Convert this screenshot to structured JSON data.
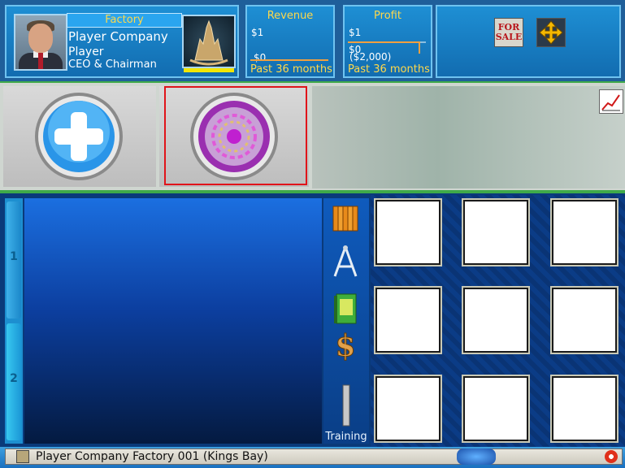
{
  "header": {
    "facility_type": "Factory",
    "company_name": "Player Company",
    "player_name": "Player",
    "player_title": "CEO & Chairman"
  },
  "revenue_chart": {
    "title": "Revenue",
    "top_label": "$1",
    "bottom_label": "$0",
    "footer": "Past 36 months",
    "line_color": "#f0a040"
  },
  "profit_chart": {
    "title": "Profit",
    "top_label": "$1",
    "mid_label": "$0",
    "bottom_label": "($2,000)",
    "footer": "Past 36 months",
    "line_color": "#f0a040"
  },
  "toolbar": {
    "for_sale_line1": "FOR",
    "for_sale_line2": "SALE",
    "move_icon": "move-arrows-icon",
    "trend_icon": "trend-chart-icon"
  },
  "main_buttons": [
    {
      "icon": "plus-icon",
      "selected": false
    },
    {
      "icon": "production-unit-icon",
      "selected": true
    }
  ],
  "side_tabs": [
    "1",
    "2"
  ],
  "side_icons": [
    "books-icon",
    "compass-icon",
    "manual-icon",
    "dollar-icon",
    "training-icon"
  ],
  "training_label": "Training",
  "status_bar": {
    "text": "Player Company Factory 001 (Kings Bay)"
  },
  "colors": {
    "accent_yellow": "#ffd84a",
    "selection_red": "#e0141a",
    "panel_blue": "#1e8fd4"
  }
}
